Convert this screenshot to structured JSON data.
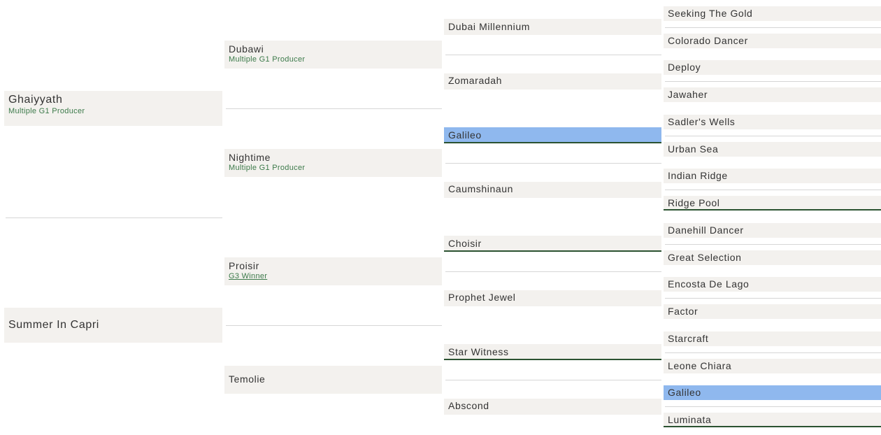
{
  "pedigree": {
    "sire": {
      "name": "Ghaiyyath",
      "note": "Multiple G1 Producer",
      "sire": {
        "name": "Dubawi",
        "note": "Multiple G1 Producer",
        "sire": {
          "name": "Dubai Millennium",
          "sire": {
            "name": "Seeking The Gold"
          },
          "dam": {
            "name": "Colorado Dancer"
          }
        },
        "dam": {
          "name": "Zomaradah",
          "sire": {
            "name": "Deploy"
          },
          "dam": {
            "name": "Jawaher"
          }
        }
      },
      "dam": {
        "name": "Nightime",
        "note": "Multiple G1 Producer",
        "sire": {
          "name": "Galileo",
          "highlight": true,
          "underline": true,
          "sire": {
            "name": "Sadler's Wells"
          },
          "dam": {
            "name": "Urban Sea"
          }
        },
        "dam": {
          "name": "Caumshinaun",
          "sire": {
            "name": "Indian Ridge"
          },
          "dam": {
            "name": "Ridge Pool",
            "underline": true
          }
        }
      }
    },
    "dam": {
      "name": "Summer In Capri",
      "sire": {
        "name": "Proisir",
        "note": "G3 Winner",
        "note_underline": true,
        "sire": {
          "name": "Choisir",
          "underline": true,
          "sire": {
            "name": "Danehill Dancer"
          },
          "dam": {
            "name": "Great Selection"
          }
        },
        "dam": {
          "name": "Prophet Jewel",
          "sire": {
            "name": "Encosta De Lago"
          },
          "dam": {
            "name": "Factor"
          }
        }
      },
      "dam": {
        "name": "Temolie",
        "sire": {
          "name": "Star Witness",
          "underline": true,
          "sire": {
            "name": "Starcraft"
          },
          "dam": {
            "name": "Leone Chiara"
          }
        },
        "dam": {
          "name": "Abscond",
          "sire": {
            "name": "Galileo",
            "highlight": true
          },
          "dam": {
            "name": "Luminata",
            "underline": true
          }
        }
      }
    }
  },
  "colors": {
    "box_background": "#f3f1ee",
    "highlight": "#8fb8ee",
    "underline": "#2b5231",
    "note_text": "#3c7a4a",
    "separator": "#d6d6d6"
  }
}
